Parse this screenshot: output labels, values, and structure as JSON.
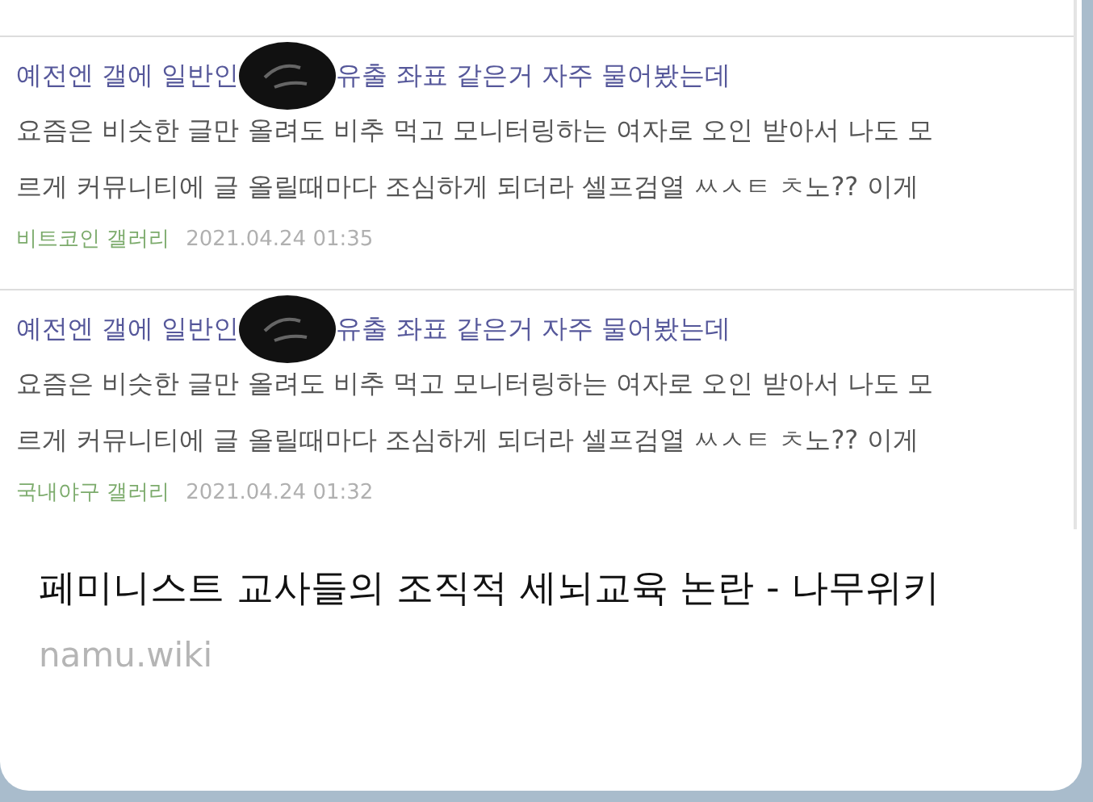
{
  "preview_image": {
    "results": [
      {
        "title_before": "예전엔 갤에 일반인",
        "title_after": "유출 좌표 같은거 자주 물어봤는데",
        "lines": [
          "요즘은 비슷한 글만 올려도 비추 먹고 모니터링하는 여자로 오인 받아서 나도 모",
          "르게 커뮤니티에 글 올릴때마다 조심하게 되더라 셀프검열 ㅆㅅㅌ ㅊ노?? 이게"
        ],
        "gallery": "비트코인 갤러리",
        "date": "2021.04.24 01:35"
      },
      {
        "title_before": "예전엔 갤에 일반인",
        "title_after": "유출 좌표 같은거 자주 물어봤는데",
        "lines": [
          "요즘은 비슷한 글만 올려도 비추 먹고 모니터링하는 여자로 오인 받아서 나도 모",
          "르게 커뮤니티에 글 올릴때마다 조심하게 되더라 셀프검열 ㅆㅅㅌ ㅊ노?? 이게"
        ],
        "gallery": "국내야구 갤러리",
        "date": "2021.04.24 01:32"
      }
    ]
  },
  "link_title": "페미니스트 교사들의 조직적 세뇌교육 논란 - 나무위키",
  "domain": "namu.wiki"
}
